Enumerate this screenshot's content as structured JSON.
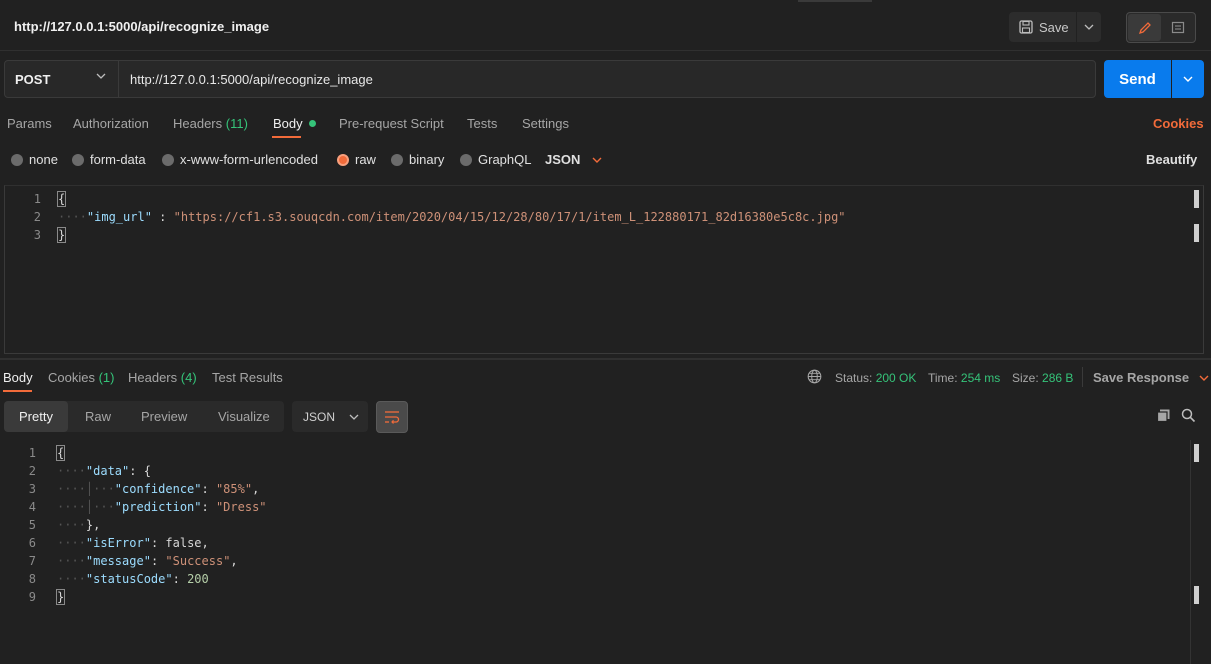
{
  "title": "http://127.0.0.1:5000/api/recognize_image",
  "toolbar": {
    "save_label": "Save"
  },
  "request": {
    "method": "POST",
    "url": "http://127.0.0.1:5000/api/recognize_image",
    "send_label": "Send"
  },
  "req_tabs": {
    "params": "Params",
    "authorization": "Authorization",
    "headers": "Headers",
    "headers_count": "(11)",
    "body": "Body",
    "pre_request": "Pre-request Script",
    "tests": "Tests",
    "settings": "Settings",
    "cookies": "Cookies"
  },
  "body_types": {
    "none": "none",
    "form_data": "form-data",
    "urlencoded": "x-www-form-urlencoded",
    "raw": "raw",
    "binary": "binary",
    "graphql": "GraphQL",
    "format": "JSON",
    "beautify": "Beautify",
    "selected": "raw"
  },
  "request_body": {
    "line_numbers": [
      "1",
      "2",
      "3"
    ],
    "open": "{",
    "key": "\"img_url\"",
    "sep": " : ",
    "value": "\"https://cf1.s3.souqcdn.com/item/2020/04/15/12/28/80/17/1/item_L_122880171_82d16380e5c8c.jpg\"",
    "close": "}"
  },
  "res_tabs": {
    "body": "Body",
    "cookies": "Cookies",
    "cookies_count": "(1)",
    "headers": "Headers",
    "headers_count": "(4)",
    "test_results": "Test Results"
  },
  "response_meta": {
    "status_label": "Status:",
    "status_value": "200 OK",
    "time_label": "Time:",
    "time_value": "254 ms",
    "size_label": "Size:",
    "size_value": "286 B",
    "save_response": "Save Response"
  },
  "view": {
    "pretty": "Pretty",
    "raw": "Raw",
    "preview": "Preview",
    "visualize": "Visualize",
    "format": "JSON"
  },
  "response_body": {
    "line_numbers": [
      "1",
      "2",
      "3",
      "4",
      "5",
      "6",
      "7",
      "8",
      "9"
    ],
    "l1": "{",
    "data_key": "\"data\"",
    "data_open": ": {",
    "confidence_key": "\"confidence\"",
    "confidence_val": "\"85%\"",
    "prediction_key": "\"prediction\"",
    "prediction_val": "\"Dress\"",
    "data_close": "},",
    "iserror_key": "\"isError\"",
    "iserror_val": "false",
    "message_key": "\"message\"",
    "message_val": "\"Success\"",
    "statuscode_key": "\"statusCode\"",
    "statuscode_val": "200",
    "l9": "}"
  },
  "colors": {
    "accent": "#f26b3a",
    "send": "#097bed",
    "success": "#35c379",
    "background": "#212121"
  }
}
